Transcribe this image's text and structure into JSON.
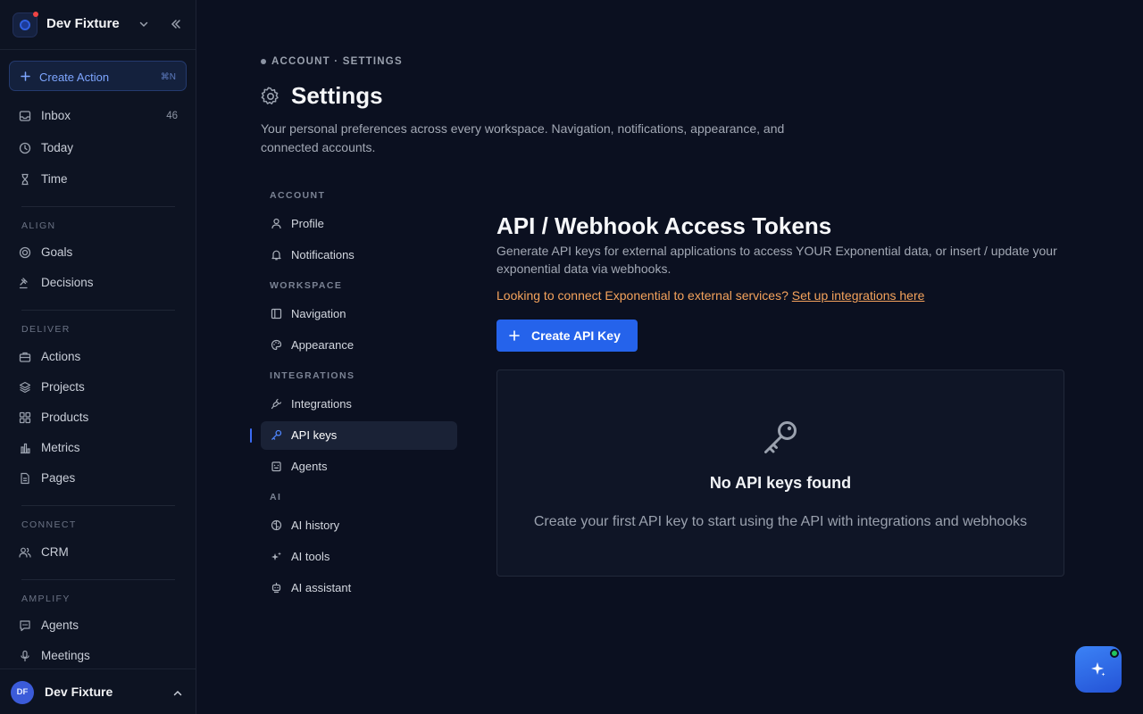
{
  "workspace": {
    "name": "Dev Fixture"
  },
  "sidebar": {
    "create_label": "Create Action",
    "create_shortcut": "⌘N",
    "top_items": [
      {
        "label": "Inbox",
        "count": "46",
        "icon": "inbox-icon"
      },
      {
        "label": "Today",
        "icon": "clock-icon"
      },
      {
        "label": "Time",
        "icon": "hourglass-icon"
      }
    ],
    "sections": [
      {
        "title": "ALIGN",
        "items": [
          {
            "label": "Goals",
            "icon": "target-icon"
          },
          {
            "label": "Decisions",
            "icon": "gavel-icon"
          }
        ]
      },
      {
        "title": "DELIVER",
        "items": [
          {
            "label": "Actions",
            "icon": "briefcase-icon"
          },
          {
            "label": "Projects",
            "icon": "layers-icon"
          },
          {
            "label": "Products",
            "icon": "grid-icon"
          },
          {
            "label": "Metrics",
            "icon": "bar-chart-icon"
          },
          {
            "label": "Pages",
            "icon": "file-icon"
          }
        ]
      },
      {
        "title": "CONNECT",
        "items": [
          {
            "label": "CRM",
            "icon": "users-icon"
          }
        ]
      },
      {
        "title": "AMPLIFY",
        "items": [
          {
            "label": "Agents",
            "icon": "chat-icon"
          },
          {
            "label": "Meetings",
            "icon": "mic-icon"
          }
        ]
      }
    ],
    "user": {
      "initials": "DF",
      "name": "Dev Fixture"
    }
  },
  "page": {
    "breadcrumb": "ACCOUNT · SETTINGS",
    "title": "Settings",
    "description": "Your personal preferences across every workspace. Navigation, notifications, appearance, and connected accounts."
  },
  "settings_nav": [
    {
      "title": "ACCOUNT",
      "items": [
        {
          "label": "Profile",
          "icon": "user-icon"
        },
        {
          "label": "Notifications",
          "icon": "bell-icon"
        }
      ]
    },
    {
      "title": "WORKSPACE",
      "items": [
        {
          "label": "Navigation",
          "icon": "sidebar-layout-icon"
        },
        {
          "label": "Appearance",
          "icon": "palette-icon"
        }
      ]
    },
    {
      "title": "INTEGRATIONS",
      "items": [
        {
          "label": "Integrations",
          "icon": "plug-icon"
        },
        {
          "label": "API keys",
          "icon": "key-icon",
          "active": true
        },
        {
          "label": "Agents",
          "icon": "bot-icon"
        }
      ]
    },
    {
      "title": "AI",
      "items": [
        {
          "label": "AI history",
          "icon": "brain-icon"
        },
        {
          "label": "AI tools",
          "icon": "sparkles-icon"
        },
        {
          "label": "AI assistant",
          "icon": "robot-icon"
        }
      ]
    }
  ],
  "content": {
    "title": "API / Webhook Access Tokens",
    "description": "Generate API keys for external applications to access YOUR Exponential data, or insert / update your exponential data via webhooks.",
    "link_prefix": "Looking to connect Exponential to external services? ",
    "link_text": "Set up integrations here",
    "create_button": "Create API Key",
    "empty_title": "No API keys found",
    "empty_description": "Create your first API key to start using the API with integrations and webhooks"
  },
  "colors": {
    "accent": "#2563eb",
    "link": "#f5a35c",
    "background": "#0b1020",
    "status_online": "#22c55e"
  }
}
